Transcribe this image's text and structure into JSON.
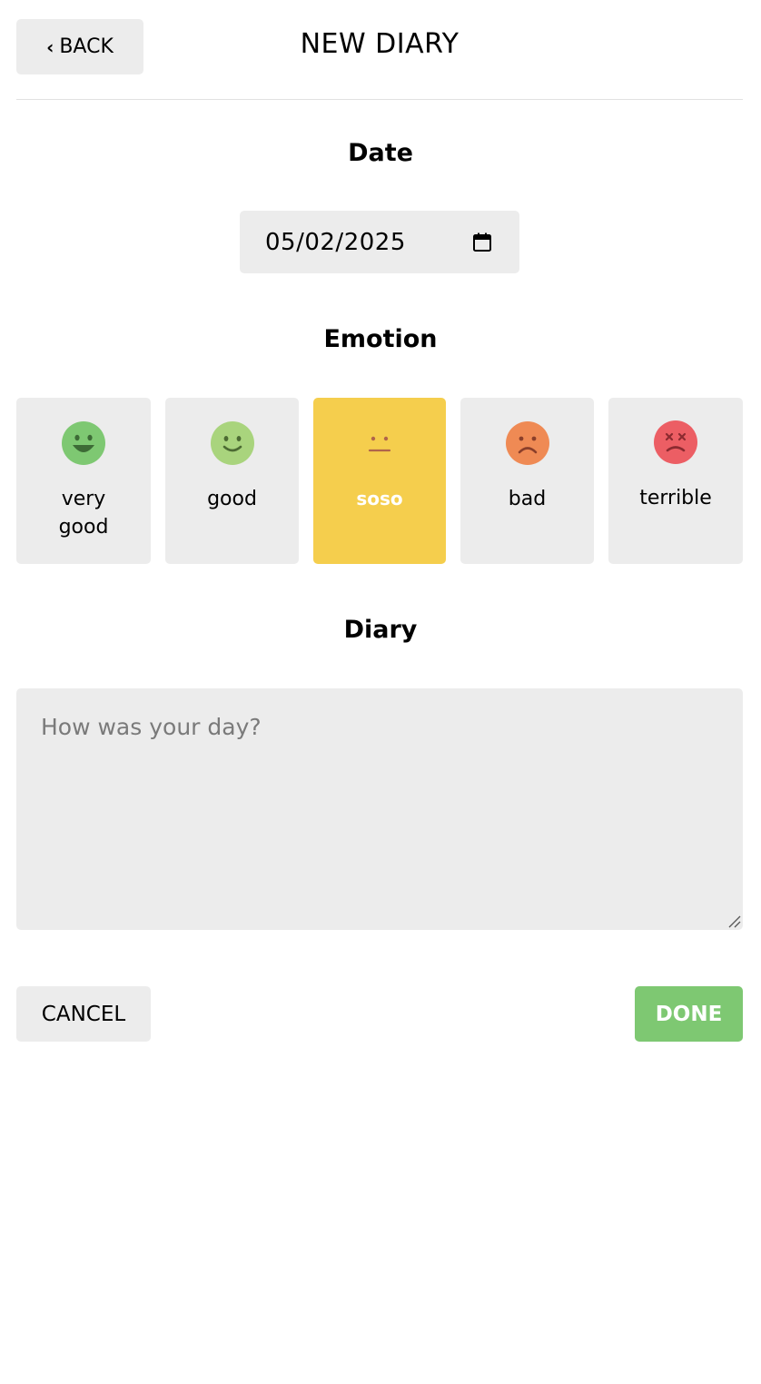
{
  "header": {
    "back_label": "BACK",
    "back_icon": "chevron-left-icon",
    "title": "NEW DIARY"
  },
  "date_section": {
    "title": "Date",
    "value": "05/02/2025",
    "icon": "calendar-icon"
  },
  "emotion_section": {
    "title": "Emotion",
    "selected": "soso",
    "items": [
      {
        "id": "very-good",
        "label": "very good",
        "color": "#7ec872",
        "icon": "grin-face-icon"
      },
      {
        "id": "good",
        "label": "good",
        "color": "#a9d47d",
        "icon": "smile-face-icon"
      },
      {
        "id": "soso",
        "label": "soso",
        "color": "#f5ce4d",
        "icon": "neutral-face-icon"
      },
      {
        "id": "bad",
        "label": "bad",
        "color": "#ef8a54",
        "icon": "frown-face-icon"
      },
      {
        "id": "terrible",
        "label": "terrible",
        "color": "#ec5e64",
        "icon": "angry-face-icon"
      }
    ]
  },
  "diary_section": {
    "title": "Diary",
    "placeholder": "How was your day?",
    "value": ""
  },
  "footer": {
    "cancel_label": "CANCEL",
    "done_label": "DONE"
  },
  "colors": {
    "selected_card": "#f5ce4d",
    "done_button": "#7ec872",
    "neutral_bg": "#ececec"
  }
}
